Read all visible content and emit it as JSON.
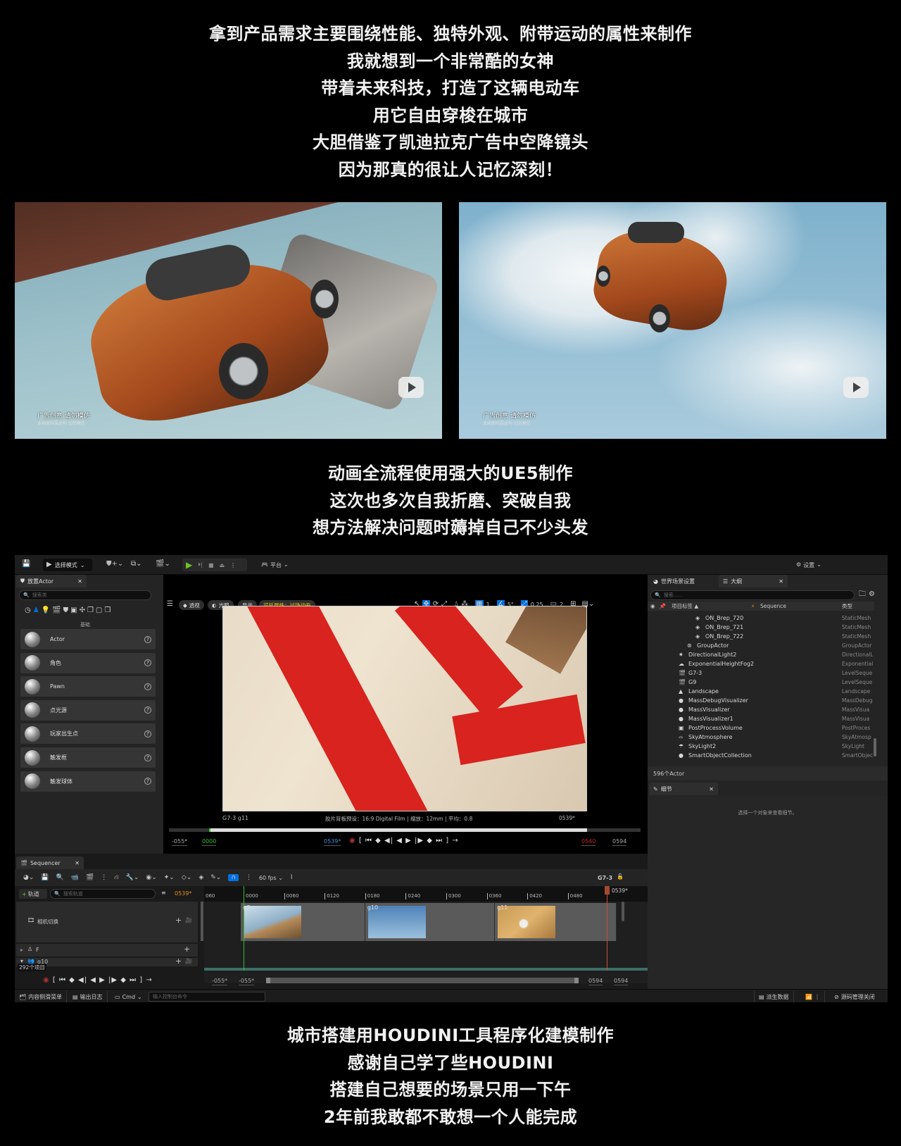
{
  "caption_top": [
    "拿到产品需求主要围绕性能、独特外观、附带运动的属性来制作",
    "我就想到一个非常酷的女神",
    "带着未来科技，打造了这辆电动车",
    "用它自由穿梭在城市",
    "大胆借鉴了凯迪拉克广告中空降镜头",
    "因为那真的很让人记忆深刻！"
  ],
  "photos": [
    {
      "subtitle": "广告创意 请勿模仿",
      "subtitle_small": "本画面纯属虚构 切勿模仿"
    },
    {
      "subtitle": "广告创意 请勿模仿",
      "subtitle_small": "本画面纯属虚构 切勿模仿"
    }
  ],
  "caption_mid": [
    "动画全流程使用强大的UE5制作",
    "这次也多次自我折磨、突破自我",
    "想方法解决问题时薅掉自己不少头发"
  ],
  "caption_bottom": [
    "城市搭建用HOUDINI工具程序化建模制作",
    "感谢自己学了些HOUDINI",
    "搭建自己想要的场景只用一下午",
    "2年前我敢都不敢想一个人能完成"
  ],
  "editor": {
    "toolbar": {
      "mode": "选择模式",
      "platform": "平台",
      "settings": "设置"
    },
    "place_actor": {
      "tab": "放置Actor",
      "search_placeholder": "搜索类",
      "category": "基础",
      "items": [
        "Actor",
        "角色",
        "Pawn",
        "点光源",
        "玩家出生点",
        "触发框",
        "触发球体"
      ]
    },
    "viewport": {
      "chips": [
        "透视",
        "光照",
        "显示"
      ],
      "cinematic": "可延展性：过场动画",
      "grid": "1",
      "angle": "5°",
      "scale": "0.25",
      "camera": "2",
      "shot": "G7-3 g11",
      "info": "胶片背板预设：16:9 Digital Film | 缩放：12mm | 平均：0.8",
      "frame": "0539*",
      "start": "-055*",
      "in": "0000",
      "current": "0539*",
      "out": "0540",
      "end": "0594"
    },
    "outliner": {
      "tab_world": "世界场景设置",
      "tab": "大纲",
      "search_placeholder": "搜索......",
      "col_label": "项目标签 ▲",
      "col_seq": "Sequence",
      "col_type": "类型",
      "rows": [
        {
          "name": "ON_Brep_720",
          "type": "StaticMesh",
          "indent": 2,
          "icon": "◈"
        },
        {
          "name": "ON_Brep_721",
          "type": "StaticMesh",
          "indent": 2,
          "icon": "◈"
        },
        {
          "name": "ON_Brep_722",
          "type": "StaticMesh",
          "indent": 2,
          "icon": "◈"
        },
        {
          "name": "GroupActor",
          "type": "GroupActor",
          "indent": 1,
          "icon": "⊛"
        },
        {
          "name": "DirectionalLight2",
          "type": "DirectionalL",
          "indent": 0,
          "icon": "✷"
        },
        {
          "name": "ExponentialHeightFog2",
          "type": "Exponential",
          "indent": 0,
          "icon": "☁"
        },
        {
          "name": "G7-3",
          "type": "LevelSeque",
          "indent": 0,
          "icon": "🎬"
        },
        {
          "name": "G9",
          "type": "LevelSeque",
          "indent": 0,
          "icon": "🎬"
        },
        {
          "name": "Landscape",
          "type": "Landscape",
          "indent": 0,
          "icon": "▲"
        },
        {
          "name": "MassDebugVisualizer",
          "type": "MassDebug",
          "indent": 0,
          "icon": "●"
        },
        {
          "name": "MassVisualizer",
          "type": "MassVisua",
          "indent": 0,
          "icon": "●"
        },
        {
          "name": "MassVisualizer1",
          "type": "MassVisua",
          "indent": 0,
          "icon": "●"
        },
        {
          "name": "PostProcessVolume",
          "type": "PostProces",
          "indent": 0,
          "icon": "▣"
        },
        {
          "name": "SkyAtmosphere",
          "type": "SkyAtmosp",
          "indent": 0,
          "icon": "⌓"
        },
        {
          "name": "SkyLight2",
          "type": "SkyLight",
          "indent": 0,
          "icon": "☂"
        },
        {
          "name": "SmartObjectCollection",
          "type": "SmartObjec",
          "indent": 0,
          "icon": "●"
        }
      ],
      "count": "596个Actor"
    },
    "details": {
      "tab": "细节",
      "empty": "选择一个对象来查看细节。"
    },
    "sequencer": {
      "tab": "Sequencer",
      "fps": "60 fps",
      "sequence": "G7-3",
      "add_track": "轨道",
      "search_placeholder": "搜索轨道",
      "current": "0539*",
      "ticks": [
        "0000",
        "0060",
        "0120",
        "0180",
        "0240",
        "0300",
        "0360",
        "0420",
        "0480"
      ],
      "tick_prev": "060",
      "tracks": [
        "相机切换",
        "F",
        "g10"
      ],
      "item_count": "292个项目",
      "clips": [
        "g7",
        "g10",
        "g11"
      ],
      "range": [
        "-055*",
        "-055*",
        "0594",
        "0594"
      ]
    },
    "statusbar": {
      "content_drawer": "内容侧滑菜单",
      "output_log": "输出日志",
      "cmd": "Cmd",
      "console_placeholder": "输入控制台命令",
      "derived_data": "派生数据",
      "source_control": "源码管理关闭"
    }
  },
  "colors": {
    "accent": "#0070e0",
    "play": "#6bc42a",
    "cinematic": "#f2c200",
    "playhead": "#c0503a"
  }
}
